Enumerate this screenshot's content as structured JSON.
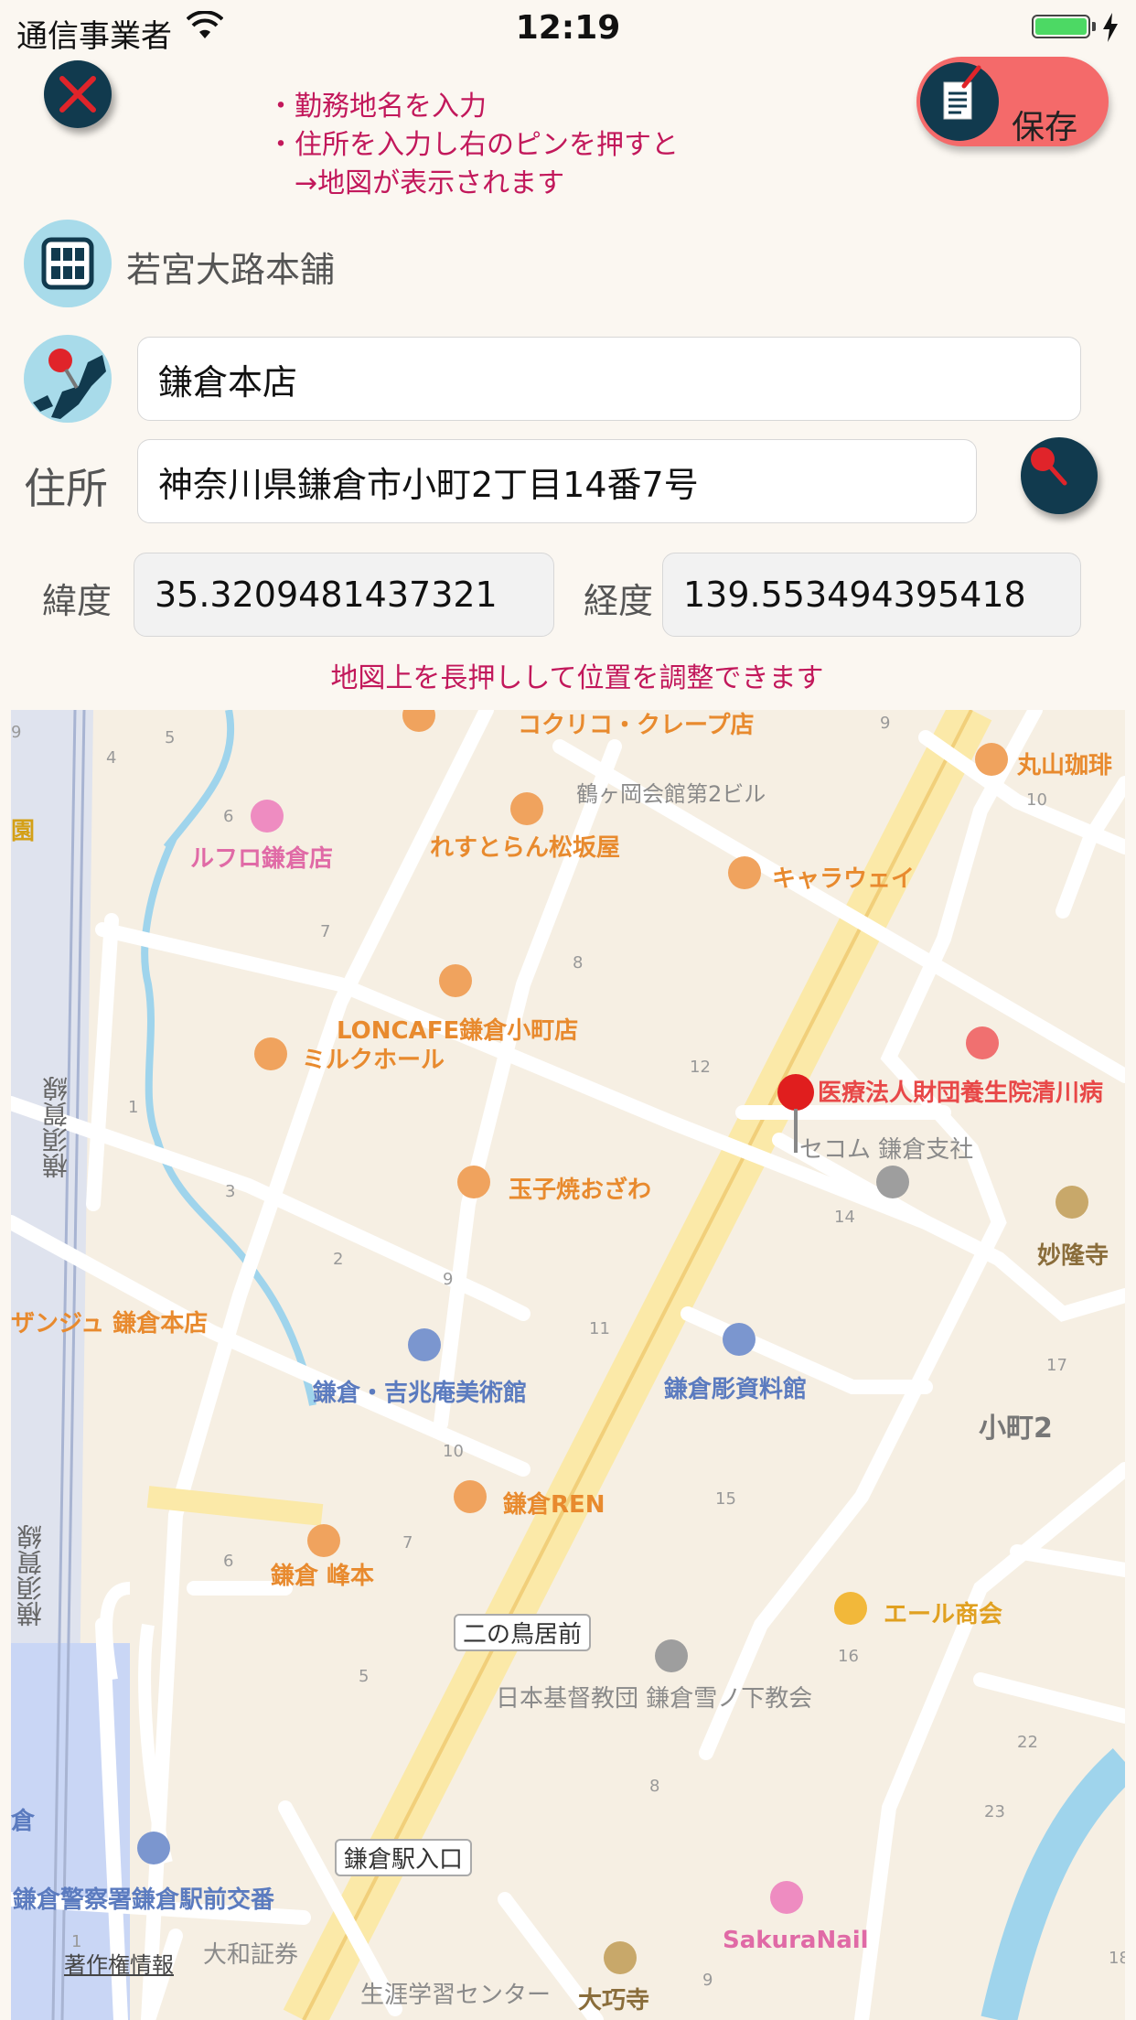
{
  "status_bar": {
    "carrier": "通信事業者",
    "time": "12:19"
  },
  "instructions": [
    "・勤務地名を入力",
    "・住所を入力し右のピンを押すと",
    "　→地図が表示されます"
  ],
  "save_button": {
    "label": "保存"
  },
  "store_name": "若宮大路本舗",
  "office": {
    "value": "鎌倉本店"
  },
  "address": {
    "label": "住所",
    "value": "神奈川県鎌倉市小町2丁目14番7号"
  },
  "latitude": {
    "label": "緯度",
    "value": "35.3209481437321"
  },
  "longitude": {
    "label": "経度",
    "value": "139.553494395418"
  },
  "map_hint": "地図上を長押しして位置を調整できます",
  "map": {
    "pois": [
      {
        "name": "コクリコ・クレープ店",
        "kind": "cafe"
      },
      {
        "name": "丸山珈琲",
        "kind": "cafe"
      },
      {
        "name": "鶴ヶ岡会館第2ビル",
        "kind": "building"
      },
      {
        "name": "ルフロ鎌倉店",
        "kind": "beauty"
      },
      {
        "name": "れすとらん松坂屋",
        "kind": "restaurant"
      },
      {
        "name": "キャラウェイ",
        "kind": "restaurant"
      },
      {
        "name": "LONCAFE鎌倉小町店",
        "kind": "cafe"
      },
      {
        "name": "ミルクホール",
        "kind": "cafe"
      },
      {
        "name": "医療法人財団養生院清川病",
        "kind": "hospital"
      },
      {
        "name": "セコム 鎌倉支社",
        "kind": "building"
      },
      {
        "name": "玉子焼おざわ",
        "kind": "restaurant"
      },
      {
        "name": "妙隆寺",
        "kind": "temple"
      },
      {
        "name": "ザンジュ 鎌倉本店",
        "kind": "restaurant"
      },
      {
        "name": "鎌倉・吉兆庵美術館",
        "kind": "museum"
      },
      {
        "name": "鎌倉彫資料館",
        "kind": "museum"
      },
      {
        "name": "小町2",
        "kind": "area"
      },
      {
        "name": "鎌倉REN",
        "kind": "restaurant"
      },
      {
        "name": "鎌倉 峰本",
        "kind": "restaurant"
      },
      {
        "name": "エール商会",
        "kind": "shop"
      },
      {
        "name": "日本基督教団 鎌倉雪ノ下教会",
        "kind": "building"
      },
      {
        "name": "鎌倉警察署鎌倉駅前交番",
        "kind": "police"
      },
      {
        "name": "大和証券",
        "kind": "building"
      },
      {
        "name": "SakuraNail",
        "kind": "beauty"
      },
      {
        "name": "大巧寺",
        "kind": "temple"
      },
      {
        "name": "生涯学習センター",
        "kind": "building"
      }
    ],
    "junctions": [
      "二の鳥居前",
      "鎌倉駅入口"
    ],
    "rail_labels": [
      "横須賀線",
      "横須賀線"
    ],
    "edge_labels": [
      "園",
      "倉"
    ],
    "block_numbers": [
      "9",
      "5",
      "4",
      "6",
      "9",
      "10",
      "7",
      "8",
      "12",
      "1",
      "3",
      "14",
      "2",
      "9",
      "11",
      "17",
      "10",
      "15",
      "7",
      "6",
      "16",
      "5",
      "22",
      "8",
      "23",
      "1",
      "9",
      "18"
    ],
    "credits": "著作権情報"
  }
}
